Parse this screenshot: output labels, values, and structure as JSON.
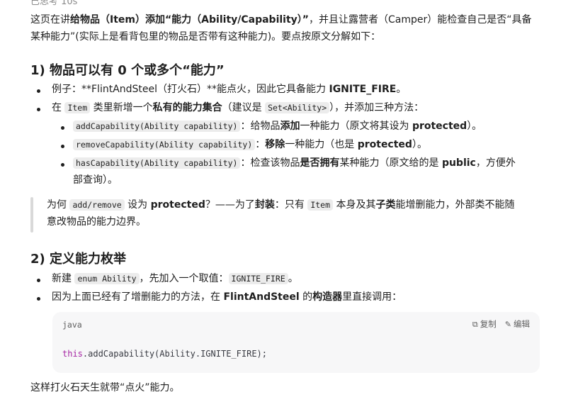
{
  "top_cut_text": "已思考 10s",
  "intro": {
    "l1_a": "这页在讲",
    "l1_b": "给物品（Item）添加“能力（Ability/Capability）”",
    "l1_c": "，并且让露营者（Camper）能检查自己是否“具备",
    "l2": "某种能力”(实际上是看背包里的物品是否带有这种能力)。要点按原文分解如下："
  },
  "section1": {
    "heading": "1) 物品可以有 0 个或多个“能力”",
    "item1_a": "例子：**FlintAndSteel（打火石）**能点火，因此它具备能力 ",
    "item1_b": "IGNITE_FIRE",
    "item1_c": "。",
    "item2_a": "在 ",
    "item2_code": "Item",
    "item2_b": " 类里新增一个",
    "item2_c": "私有的能力集合",
    "item2_d": "（建议是 ",
    "item2_code2": "Set<Ability>",
    "item2_e": "），并添加三种方法：",
    "sub1_code": "addCapability(Ability capability)",
    "sub1_a": "：给物品",
    "sub1_b": "添加",
    "sub1_c": "一种能力（原文将其设为 ",
    "sub1_d": "protected",
    "sub1_e": "）。",
    "sub2_code": "removeCapability(Ability capability)",
    "sub2_a": "：",
    "sub2_b": "移除",
    "sub2_c": "一种能力（也是 ",
    "sub2_d": "protected",
    "sub2_e": "）。",
    "sub3_code": "hasCapability(Ability capability)",
    "sub3_a": "：检查该物品",
    "sub3_b": "是否拥有",
    "sub3_c": "某种能力（原文给的是 ",
    "sub3_d": "public",
    "sub3_e": "，方便外",
    "sub3_l2": "部查询）。",
    "quote_a": "为何 ",
    "quote_code": "add/remove",
    "quote_b": " 设为 ",
    "quote_c": "protected",
    "quote_d": "？——为了",
    "quote_e": "封装",
    "quote_f": "：只有 ",
    "quote_code2": "Item",
    "quote_g": " 本身及其",
    "quote_h": "子类",
    "quote_i": "能增删能力，外部类不能随",
    "quote_l2": "意改物品的能力边界。"
  },
  "section2": {
    "heading": "2) 定义能力枚举",
    "item1_a": "新建 ",
    "item1_code": "enum Ability",
    "item1_b": "，先加入一个取值：",
    "item1_code2": "IGNITE_FIRE",
    "item1_c": "。",
    "item2_a": "因为上面已经有了增删能力的方法，在 ",
    "item2_b": "FlintAndSteel",
    "item2_c": " 的",
    "item2_d": "构造器",
    "item2_e": "里直接调用：",
    "code_lang": "java",
    "copy_label": "复制",
    "edit_label": "编辑",
    "code_kw": "this",
    "code_rest": ".addCapability(Ability.IGNITE_FIRE);",
    "outro": "这样打火石天生就带“点火”能力。"
  }
}
